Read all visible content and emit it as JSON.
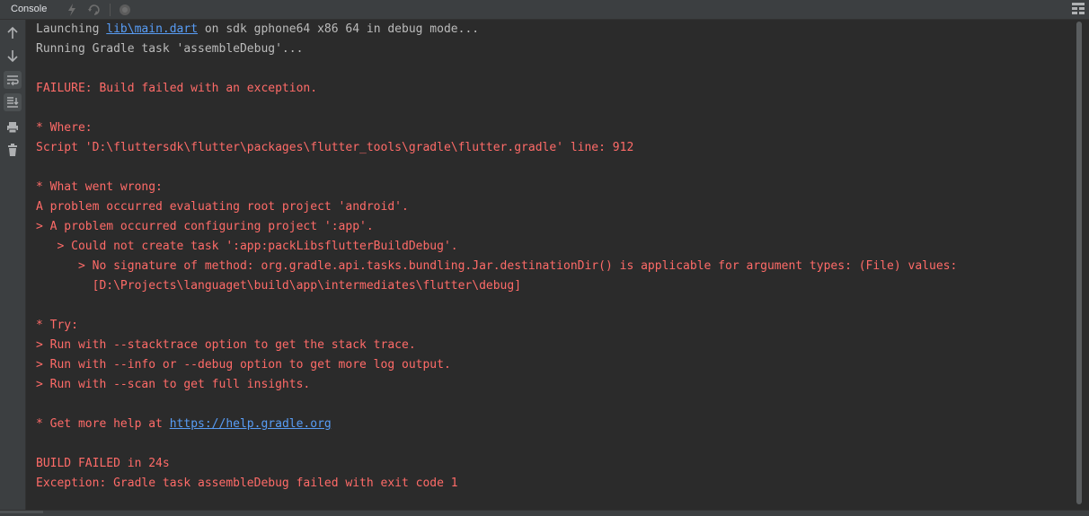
{
  "header": {
    "tab_label": "Console"
  },
  "console": {
    "lines": [
      {
        "pre": "Launching ",
        "link": "lib\\main.dart",
        "post": " on sdk gphone64 x86 64 in debug mode..."
      },
      {
        "text": "Running Gradle task 'assembleDebug'..."
      },
      {
        "text": ""
      },
      {
        "text": "FAILURE: Build failed with an exception."
      },
      {
        "text": ""
      },
      {
        "text": "* Where:"
      },
      {
        "text": "Script 'D:\\fluttersdk\\flutter\\packages\\flutter_tools\\gradle\\flutter.gradle' line: 912"
      },
      {
        "text": ""
      },
      {
        "text": "* What went wrong:"
      },
      {
        "text": "A problem occurred evaluating root project 'android'."
      },
      {
        "text": "> A problem occurred configuring project ':app'."
      },
      {
        "text": "   > Could not create task ':app:packLibsflutterBuildDebug'."
      },
      {
        "text": "      > No signature of method: org.gradle.api.tasks.bundling.Jar.destinationDir() is applicable for argument types: (File) values:"
      },
      {
        "text": "        [D:\\Projects\\languaget\\build\\app\\intermediates\\flutter\\debug]"
      },
      {
        "text": ""
      },
      {
        "text": "* Try:"
      },
      {
        "text": "> Run with --stacktrace option to get the stack trace."
      },
      {
        "text": "> Run with --info or --debug option to get more log output."
      },
      {
        "text": "> Run with --scan to get full insights."
      },
      {
        "text": ""
      },
      {
        "pre": "* Get more help at ",
        "link": "https://help.gradle.org",
        "post": ""
      },
      {
        "text": ""
      },
      {
        "text": "BUILD FAILED in 24s"
      },
      {
        "text": "Exception: Gradle task assembleDebug failed with exit code 1"
      }
    ]
  },
  "colors": {
    "background": "#2b2b2b",
    "panel": "#3c3f41",
    "normal_text": "#bbbbbb",
    "error_text": "#ff6b68",
    "link": "#589df6"
  }
}
